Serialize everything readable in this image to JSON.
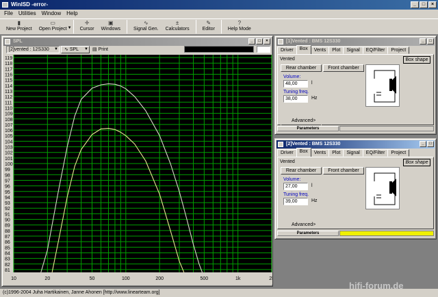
{
  "app": {
    "title": "WinISD -error-"
  },
  "menu": [
    "File",
    "Utilities",
    "Window",
    "Help"
  ],
  "toolbar": [
    {
      "label": "New Project",
      "icon": "new-project-icon",
      "glyph": "▮"
    },
    {
      "label": "Open Project",
      "icon": "open-project-icon",
      "glyph": "▭",
      "dropdown": true
    },
    {
      "label": "Cursor",
      "icon": "cursor-icon",
      "glyph": "✛"
    },
    {
      "label": "Windows",
      "icon": "windows-icon",
      "glyph": "▣"
    },
    {
      "label": "Signal Gen.",
      "icon": "signal-generator-icon",
      "glyph": "∿"
    },
    {
      "label": "Calculators",
      "icon": "calculator-icon",
      "glyph": "±"
    },
    {
      "label": "Editor",
      "icon": "editor-icon",
      "glyph": "✎"
    },
    {
      "label": "Help Mode",
      "icon": "help-icon",
      "glyph": "?"
    }
  ],
  "spl_window": {
    "title": "SPL",
    "project_select": "[2]vented : 12S330",
    "graph_select": "SPL",
    "print_label": "Print"
  },
  "chart_data": {
    "type": "line",
    "title": "",
    "xlabel": "",
    "ylabel": "",
    "x_scale": "log",
    "xlim": [
      10,
      2000
    ],
    "ylim": [
      80.5,
      119.5
    ],
    "x_ticks": [
      10,
      20,
      50,
      100,
      200,
      500,
      1000,
      2000
    ],
    "x_tick_labels": [
      "10",
      "20",
      "50",
      "100",
      "200",
      "500",
      "1k",
      "2k"
    ],
    "y_ticks": [
      81,
      82,
      83,
      84,
      85,
      86,
      87,
      88,
      89,
      90,
      91,
      92,
      93,
      94,
      95,
      96,
      97,
      98,
      99,
      100,
      101,
      102,
      103,
      104,
      105,
      106,
      107,
      108,
      109,
      110,
      111,
      112,
      113,
      114,
      115,
      116,
      117,
      118,
      119
    ],
    "grid": true,
    "background": "#000000",
    "grid_color": "#00a000",
    "series": [
      {
        "color": "#d8d8c8",
        "x": [
          17.5,
          20,
          25,
          30,
          35,
          40,
          50,
          60,
          70,
          80,
          90,
          100,
          120,
          150,
          200,
          250,
          300,
          350,
          400,
          450,
          480
        ],
        "y": [
          80.5,
          84.5,
          95,
          103,
          108.5,
          111.5,
          113.5,
          114.1,
          114.3,
          114.2,
          113.9,
          113.4,
          112.0,
          109.5,
          105,
          100,
          95,
          90,
          85.5,
          82,
          80.5
        ]
      },
      {
        "color": "#e8e890",
        "x": [
          22,
          25,
          30,
          35,
          40,
          50,
          60,
          70,
          80,
          90,
          100,
          120,
          150,
          200,
          250,
          300,
          330
        ],
        "y": [
          80.5,
          86,
          94,
          99.5,
          102.5,
          105.2,
          106.2,
          106.3,
          106.1,
          105.6,
          105,
          103.5,
          100.5,
          94.5,
          88,
          82.5,
          80.5
        ]
      }
    ]
  },
  "box_window_1": {
    "title": "[1]Vented : BMS 12S330",
    "tabs": [
      "Driver",
      "Box",
      "Vents",
      "Plot",
      "Signal",
      "EQ/Filter",
      "Project"
    ],
    "active_tab": "Box",
    "type_label": "Vented",
    "box_shape_button": "Box shape",
    "rear_chamber_button": "Rear chamber",
    "front_chamber_button": "Front chamber",
    "volume_label": "Volume:",
    "volume_value": "48,00",
    "volume_unit": "l",
    "tuning_label": "Tuning freq.",
    "tuning_value": "38,00",
    "tuning_unit": "Hz",
    "advanced_label": "Advanced>",
    "parameters_label": "Parameters"
  },
  "box_window_2": {
    "title": "[2]Vented : BMS 12S330",
    "tabs": [
      "Driver",
      "Box",
      "Vents",
      "Plot",
      "Signal",
      "EQ/Filter",
      "Project"
    ],
    "active_tab": "Box",
    "type_label": "Vented",
    "box_shape_button": "Box shape",
    "rear_chamber_button": "Rear chamber",
    "front_chamber_button": "Front chamber",
    "volume_label": "Volume:",
    "volume_value": "27,00",
    "volume_unit": "l",
    "tuning_label": "Tuning freq.",
    "tuning_value": "39,00",
    "tuning_unit": "Hz",
    "advanced_label": "Advanced>",
    "parameters_label": "Parameters",
    "status_color": "#f0f000"
  },
  "statusbar": {
    "text": "(c)1996-2004 Juha Hartikainen, Janne Ahonen [http://www.linearteam.org]"
  },
  "watermark": "hifi-forum.de"
}
